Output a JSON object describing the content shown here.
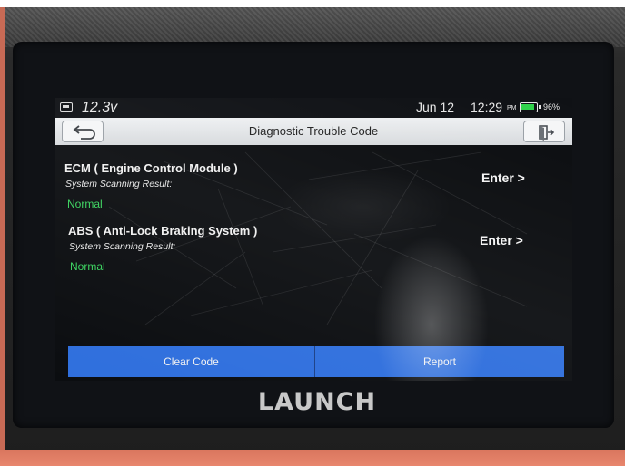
{
  "status_bar": {
    "voltage": "12.3v",
    "date": "Jun 12",
    "time": "12:29",
    "ampm": "PM",
    "battery_percent": "96%",
    "battery_level": 0.96,
    "battery_color": "#2fd24a"
  },
  "header": {
    "title": "Diagnostic Trouble Code",
    "back_icon": "back-arrow-icon",
    "exit_icon": "exit-door-icon"
  },
  "systems": [
    {
      "name": "ECM ( Engine Control Module )",
      "scan_label": "System Scanning Result:",
      "result": "Normal",
      "action": "Enter >"
    },
    {
      "name": "ABS ( Anti-Lock Braking System )",
      "scan_label": "System Scanning Result:",
      "result": "Normal",
      "action": "Enter >"
    }
  ],
  "footer": {
    "clear_label": "Clear Code",
    "report_label": "Report",
    "accent": "#2f6fdd"
  },
  "device": {
    "brand": "LAUNCH"
  },
  "colors": {
    "result_ok": "#39d45e",
    "screen_bg": "#0b0d10"
  }
}
